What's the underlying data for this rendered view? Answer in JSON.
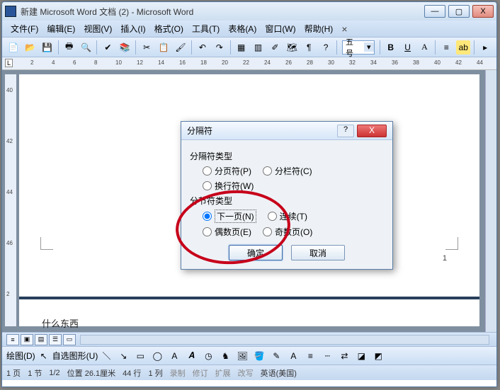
{
  "window": {
    "title": "新建 Microsoft Word 文档 (2) - Microsoft Word",
    "min": "—",
    "max": "▢",
    "close": "X"
  },
  "menu": {
    "file": "文件(F)",
    "edit": "编辑(E)",
    "view": "视图(V)",
    "insert": "插入(I)",
    "format": "格式(O)",
    "tools": "工具(T)",
    "table": "表格(A)",
    "window": "窗口(W)",
    "help": "帮助(H)"
  },
  "toolbar": {
    "fontsize": "五号",
    "B": "B",
    "U": "U"
  },
  "ruler": {
    "corner": "L",
    "marks": [
      2,
      4,
      6,
      8,
      10,
      12,
      14,
      16,
      18,
      20,
      22,
      24,
      26,
      28,
      30,
      32,
      34,
      36,
      38,
      40,
      42,
      44
    ]
  },
  "vruler": {
    "marks": [
      "40",
      "42",
      "44",
      "46",
      "2"
    ]
  },
  "doc": {
    "pagenum": "1",
    "text": "什么东西"
  },
  "dialog": {
    "title": "分隔符",
    "help": "?",
    "close": "X",
    "group1": "分隔符类型",
    "r1": "分页符(P)",
    "r2": "分栏符(C)",
    "r3": "换行符(W)",
    "group2": "分节符类型",
    "r4": "下一页(N)",
    "r5": "连续(T)",
    "r6": "偶数页(E)",
    "r7": "奇数页(O)",
    "ok": "确定",
    "cancel": "取消"
  },
  "drawbar": {
    "label": "绘图(D)",
    "autoshape": "自选图形(U)"
  },
  "status": {
    "page": "1 页",
    "sec": "1 节",
    "pages": "1/2",
    "pos": "位置 26.1厘米",
    "line": "44 行",
    "col": "1 列",
    "rec": "录制",
    "rev": "修订",
    "ext": "扩展",
    "ovr": "改写",
    "lang": "英语(美国)"
  }
}
